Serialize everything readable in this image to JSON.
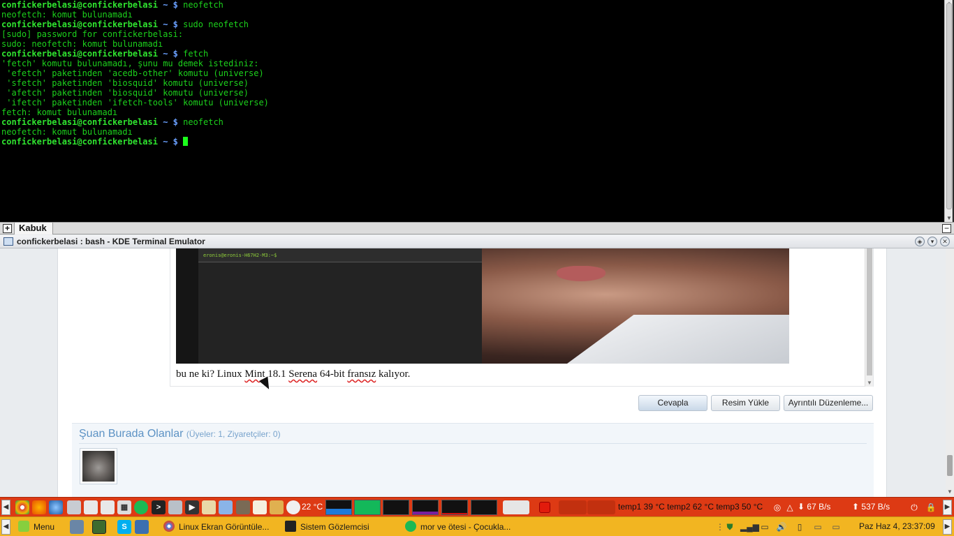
{
  "terminal": {
    "lines": [
      {
        "user": "confickerbelasi@confickerbelasi",
        "path": "~ $",
        "cmd": "neofetch"
      },
      {
        "out": "neofetch: komut bulunamadı"
      },
      {
        "user": "confickerbelasi@confickerbelasi",
        "path": "~ $",
        "cmd": "sudo neofetch"
      },
      {
        "out": "[sudo] password for confickerbelasi:"
      },
      {
        "out": "sudo: neofetch: komut bulunamadı"
      },
      {
        "user": "confickerbelasi@confickerbelasi",
        "path": "~ $",
        "cmd": "fetch"
      },
      {
        "out": "'fetch' komutu bulunamadı, şunu mu demek istediniz:"
      },
      {
        "out": " 'efetch' paketinden 'acedb-other' komutu (universe)"
      },
      {
        "out": " 'sfetch' paketinden 'biosquid' komutu (universe)"
      },
      {
        "out": " 'afetch' paketinden 'biosquid' komutu (universe)"
      },
      {
        "out": " 'ifetch' paketinden 'ifetch-tools' komutu (universe)"
      },
      {
        "out": "fetch: komut bulunamadı"
      },
      {
        "user": "confickerbelasi@confickerbelasi",
        "path": "~ $",
        "cmd": "neofetch"
      },
      {
        "out": "neofetch: komut bulunamadı"
      },
      {
        "user": "confickerbelasi@confickerbelasi",
        "path": "~ $",
        "cmd": "",
        "cursor": true
      }
    ],
    "tab_label": "Kabuk",
    "window_title": "confickerbelasi : bash - KDE Terminal Emulator"
  },
  "post": {
    "embedded_prompt": "eronis@eronis-H67H2-M3:~$",
    "text_parts": [
      "bu ne ki? Linux ",
      "Mint",
      " 18.1 ",
      "Serena",
      " 64-bit ",
      "fransız",
      " kalıyor."
    ]
  },
  "buttons": {
    "reply": "Cevapla",
    "upload_image": "Resim Yükle",
    "advanced_edit": "Ayrıntılı Düzenleme..."
  },
  "online": {
    "title": "Şuan Burada Olanlar",
    "subtitle": "(Üyeler: 1, Ziyaretçiler: 0)"
  },
  "panel_top": {
    "weather": "22 °C",
    "temps": "temp1 39 °C temp2 62 °C temp3 50 °C",
    "download": "67 B/s",
    "upload": "537 B/s"
  },
  "panel_bottom": {
    "menu_label": "Menu",
    "tasks": [
      {
        "label": "Linux Ekran Görüntüle...",
        "icon": "chrome-icon"
      },
      {
        "label": "Sistem Gözlemcisi",
        "icon": "monitor-icon"
      },
      {
        "label": "mor ve ötesi - Çocukla...",
        "icon": "spotify-icon"
      }
    ],
    "clock": "Paz Haz  4, 23:37:09"
  },
  "colors": {
    "panel_top": "#dd3a14",
    "panel_bottom": "#f2b521",
    "terminal_text": "#1cd11c",
    "prompt_path": "#6aa0ff",
    "online_title": "#5c92c4"
  }
}
